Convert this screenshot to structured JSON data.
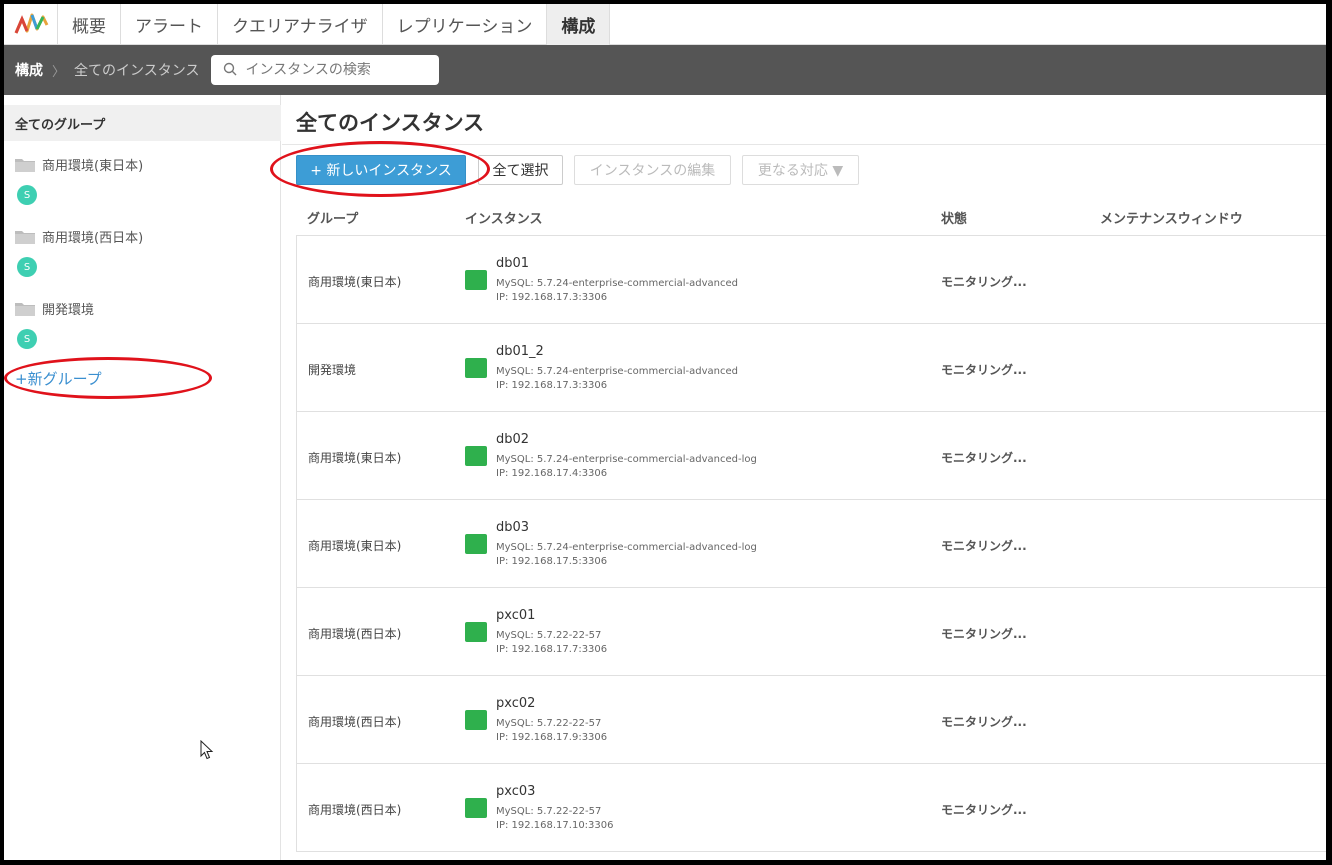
{
  "nav": {
    "tabs": [
      "概要",
      "アラート",
      "クエリアナライザ",
      "レプリケーション",
      "構成"
    ],
    "active_tab": "構成"
  },
  "breadcrumb": {
    "root": "構成",
    "separator": "〉",
    "current": "全てのインスタンス"
  },
  "search": {
    "placeholder": "インスタンスの検索"
  },
  "sidebar": {
    "header": "全てのグループ",
    "groups": [
      {
        "name": "商用環境(東日本)",
        "badge": "S"
      },
      {
        "name": "商用環境(西日本)",
        "badge": "S"
      },
      {
        "name": "開発環境",
        "badge": "S"
      }
    ],
    "new_group": "+新グループ"
  },
  "main": {
    "title": "全てのインスタンス",
    "buttons": {
      "new_instance": "+ 新しいインスタンス",
      "select_all": "全て選択",
      "edit_instance": "インスタンスの編集",
      "more_actions": "更なる対応 ▼"
    },
    "columns": [
      "グループ",
      "インスタンス",
      "状態",
      "メンテナンスウィンドウ"
    ],
    "rows": [
      {
        "group": "商用環境(東日本)",
        "name": "db01",
        "version": "MySQL: 5.7.24-enterprise-commercial-advanced",
        "ip": "IP: 192.168.17.3:3306",
        "state": "モニタリング..."
      },
      {
        "group": "開発環境",
        "name": "db01_2",
        "version": "MySQL: 5.7.24-enterprise-commercial-advanced",
        "ip": "IP: 192.168.17.3:3306",
        "state": "モニタリング..."
      },
      {
        "group": "商用環境(東日本)",
        "name": "db02",
        "version": "MySQL: 5.7.24-enterprise-commercial-advanced-log",
        "ip": "IP: 192.168.17.4:3306",
        "state": "モニタリング..."
      },
      {
        "group": "商用環境(東日本)",
        "name": "db03",
        "version": "MySQL: 5.7.24-enterprise-commercial-advanced-log",
        "ip": "IP: 192.168.17.5:3306",
        "state": "モニタリング..."
      },
      {
        "group": "商用環境(西日本)",
        "name": "pxc01",
        "version": "MySQL: 5.7.22-22-57",
        "ip": "IP: 192.168.17.7:3306",
        "state": "モニタリング..."
      },
      {
        "group": "商用環境(西日本)",
        "name": "pxc02",
        "version": "MySQL: 5.7.22-22-57",
        "ip": "IP: 192.168.17.9:3306",
        "state": "モニタリング..."
      },
      {
        "group": "商用環境(西日本)",
        "name": "pxc03",
        "version": "MySQL: 5.7.22-22-57",
        "ip": "IP: 192.168.17.10:3306",
        "state": "モニタリング..."
      }
    ]
  },
  "colors": {
    "accent": "#3d9dd6",
    "badge": "#3ecfb2",
    "highlight": "#e0121b",
    "mysql_icon": "#2fb04d"
  },
  "icons": [
    "logo-icon",
    "search-icon",
    "folder-icon",
    "mysql-icon",
    "mouse-cursor-icon"
  ]
}
